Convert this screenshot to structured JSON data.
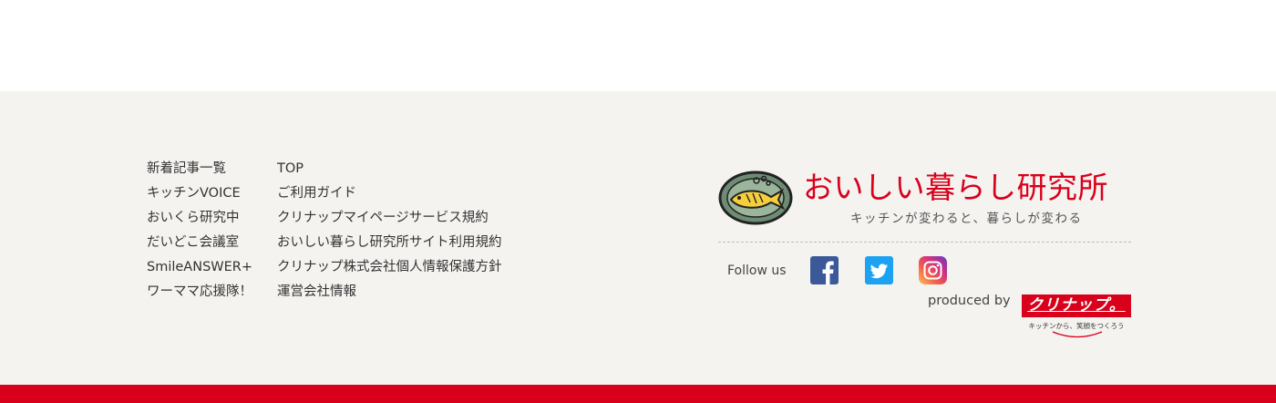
{
  "nav": {
    "column1": [
      "新着記事一覧",
      "キッチンVOICE",
      "おいくら研究中",
      "だいどこ会議室",
      "SmileANSWER+",
      "ワーママ応援隊！"
    ],
    "column2": [
      "TOP",
      "ご利用ガイド",
      "クリナップマイページサービス規約",
      "おいしい暮らし研究所サイト利用規約",
      "クリナップ株式会社個人情報保護方針",
      "運営会社情報"
    ]
  },
  "brand": {
    "title": "おいしい暮らし研究所",
    "tagline": "キッチンが変わると、暮らしが変わる",
    "logo_icon": "fish-plate-icon"
  },
  "social": {
    "label": "Follow us",
    "items": [
      {
        "name": "facebook",
        "icon": "facebook-icon",
        "color": "#3b5998"
      },
      {
        "name": "twitter",
        "icon": "twitter-icon",
        "color": "#1da1f2"
      },
      {
        "name": "instagram",
        "icon": "instagram-icon",
        "color": "#c13584"
      }
    ]
  },
  "producer": {
    "label": "produced by",
    "logo_text": "クリナップ。",
    "tagline": "キッチンから、笑顔をつくろう"
  },
  "colors": {
    "accent": "#d9001b",
    "footer_bg": "#f4f3f0",
    "text": "#333333"
  }
}
